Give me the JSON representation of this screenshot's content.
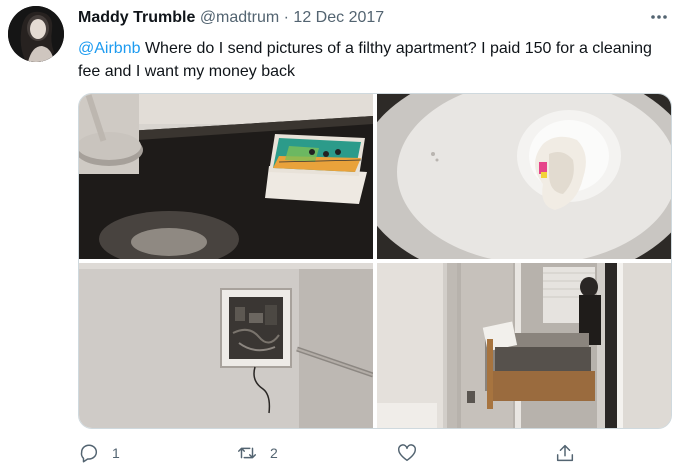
{
  "tweet": {
    "author_name": "Maddy Trumble",
    "handle": "@madtrum",
    "separator": "·",
    "date": "12 Dec 2017",
    "mention": "@Airbnb",
    "text": " Where do I send pictures of a filthy apartment? I paid 150 for a cleaning fee and I want my money back"
  },
  "actions": {
    "reply_count": "1",
    "retweet_count": "2"
  },
  "icons": {
    "reply": "reply-icon",
    "retweet": "retweet-icon",
    "like": "heart-icon",
    "share": "share-icon",
    "more": "more-options-icon"
  },
  "colors": {
    "link": "#1d9bf0",
    "secondary_text": "#536471",
    "primary_text": "#0f1419"
  }
}
